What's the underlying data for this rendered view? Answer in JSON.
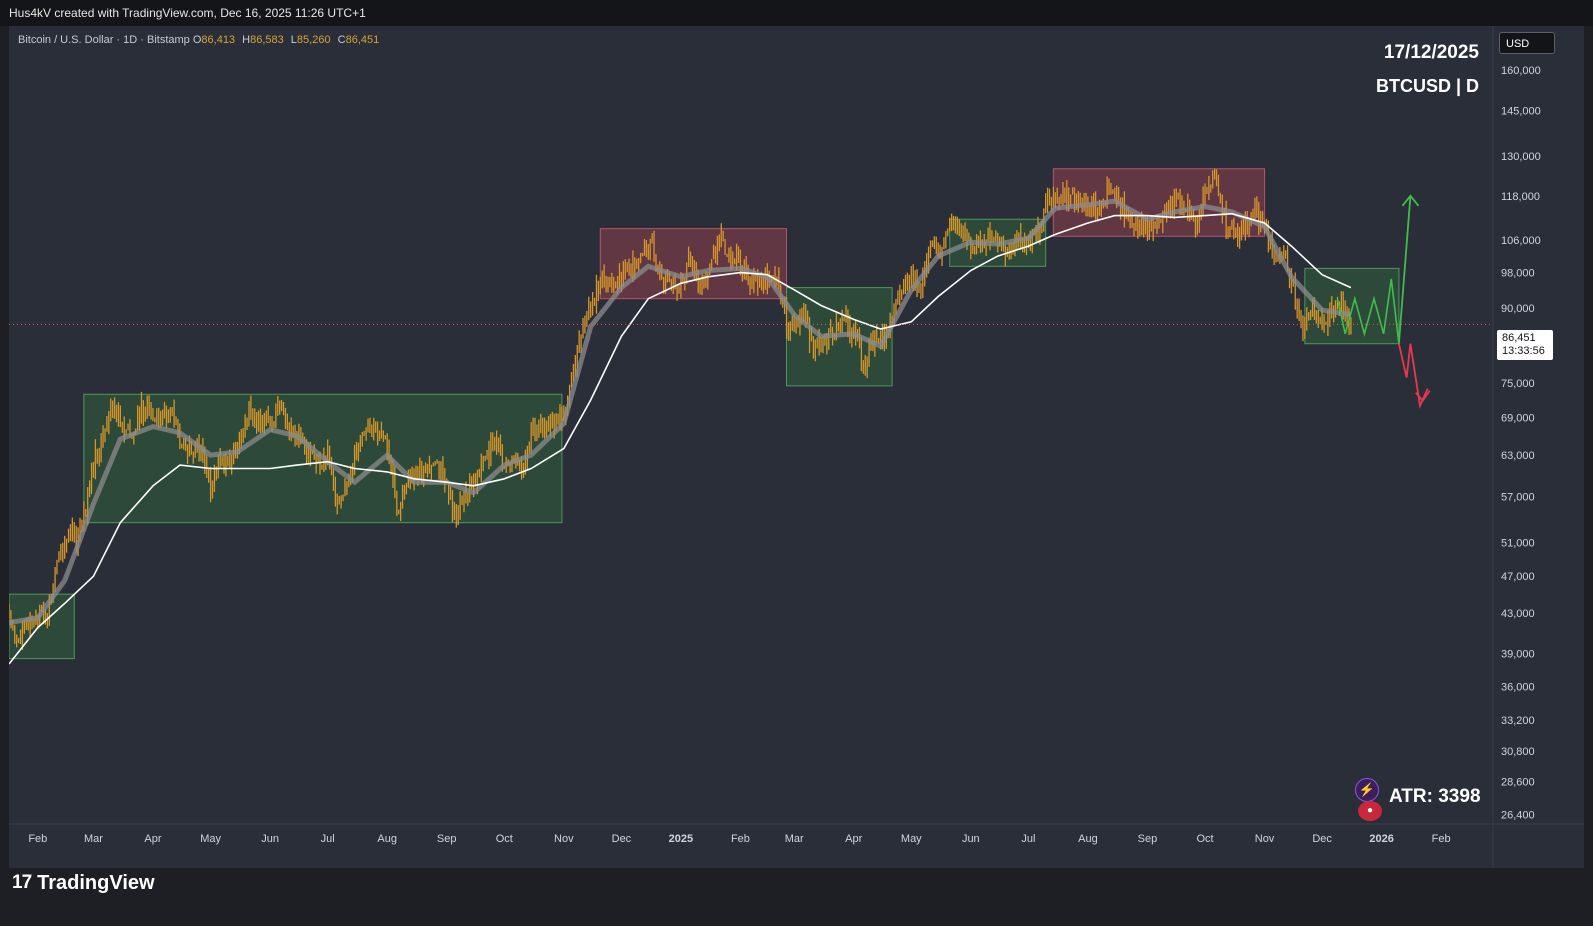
{
  "header": {
    "attribution": "Hus4kV created with TradingView.com, Dec 16, 2025 11:26 UTC+1"
  },
  "symbol": {
    "description": "Bitcoin / U.S. Dollar · 1D · Bitstamp",
    "o_label": "O",
    "o_value": "86,413",
    "h_label": "H",
    "h_value": "86,583",
    "l_label": "L",
    "l_value": "85,260",
    "c_label": "C",
    "c_value": "86,451"
  },
  "overlay": {
    "date": "17/12/2025",
    "pair": "BTCUSD | D",
    "atr": "ATR: 3398"
  },
  "currency_button": "USD",
  "last_price": {
    "price": "86,451",
    "countdown": "13:33:56"
  },
  "brand": {
    "logo": "17",
    "name": "TradingView"
  },
  "colors": {
    "candle": "#d6962a",
    "ema_white": "#ffffff",
    "ema_gray": "#8c8c8c",
    "green_box": "#2f6b3a",
    "red_box": "#8e3f4f",
    "projection_up": "#3fbf4a",
    "projection_down": "#e6394e",
    "background": "#2a2e39"
  },
  "chart_data": {
    "type": "candlestick",
    "title": "Bitcoin / U.S. Dollar · 1D · Bitstamp",
    "scale": "log",
    "ylim": [
      25800,
      178000
    ],
    "y_ticks": [
      160000,
      145000,
      130000,
      118000,
      106000,
      98000,
      90000,
      75000,
      69000,
      63000,
      57000,
      51000,
      47000,
      43000,
      39000,
      36000,
      33200,
      30800,
      28600,
      26400
    ],
    "y_tick_labels": [
      "160,000",
      "145,000",
      "130,000",
      "118,000",
      "106,000",
      "98,000",
      "90,000",
      "75,000",
      "69,000",
      "63,000",
      "57,000",
      "51,000",
      "47,000",
      "43,000",
      "39,000",
      "36,000",
      "33,200",
      "30,800",
      "28,600",
      "26,400"
    ],
    "x_range": [
      "2024-01-17",
      "2026-02-28"
    ],
    "x_ticks": [
      {
        "date": "2024-02-01",
        "label": "Feb"
      },
      {
        "date": "2024-03-01",
        "label": "Mar"
      },
      {
        "date": "2024-04-01",
        "label": "Apr"
      },
      {
        "date": "2024-05-01",
        "label": "May"
      },
      {
        "date": "2024-06-01",
        "label": "Jun"
      },
      {
        "date": "2024-07-01",
        "label": "Jul"
      },
      {
        "date": "2024-08-01",
        "label": "Aug"
      },
      {
        "date": "2024-09-01",
        "label": "Sep"
      },
      {
        "date": "2024-10-01",
        "label": "Oct"
      },
      {
        "date": "2024-11-01",
        "label": "Nov"
      },
      {
        "date": "2024-12-01",
        "label": "Dec"
      },
      {
        "date": "2025-01-01",
        "label": "2025"
      },
      {
        "date": "2025-02-01",
        "label": "Feb"
      },
      {
        "date": "2025-03-01",
        "label": "Mar"
      },
      {
        "date": "2025-04-01",
        "label": "Apr"
      },
      {
        "date": "2025-05-01",
        "label": "May"
      },
      {
        "date": "2025-06-01",
        "label": "Jun"
      },
      {
        "date": "2025-07-01",
        "label": "Jul"
      },
      {
        "date": "2025-08-01",
        "label": "Aug"
      },
      {
        "date": "2025-09-01",
        "label": "Sep"
      },
      {
        "date": "2025-10-01",
        "label": "Oct"
      },
      {
        "date": "2025-11-01",
        "label": "Nov"
      },
      {
        "date": "2025-12-01",
        "label": "Dec"
      },
      {
        "date": "2026-01-01",
        "label": "2026"
      },
      {
        "date": "2026-02-01",
        "label": "Feb"
      }
    ],
    "close_series": [
      [
        "2024-01-17",
        42700
      ],
      [
        "2024-01-22",
        40000
      ],
      [
        "2024-01-27",
        41800
      ],
      [
        "2024-02-01",
        43000
      ],
      [
        "2024-02-06",
        43000
      ],
      [
        "2024-02-11",
        48200
      ],
      [
        "2024-02-16",
        52000
      ],
      [
        "2024-02-21",
        51500
      ],
      [
        "2024-02-26",
        55000
      ],
      [
        "2024-03-01",
        62000
      ],
      [
        "2024-03-06",
        66000
      ],
      [
        "2024-03-11",
        71500
      ],
      [
        "2024-03-16",
        67000
      ],
      [
        "2024-03-21",
        66000
      ],
      [
        "2024-03-26",
        70500
      ],
      [
        "2024-04-01",
        69500
      ],
      [
        "2024-04-06",
        69000
      ],
      [
        "2024-04-11",
        70000
      ],
      [
        "2024-04-16",
        63500
      ],
      [
        "2024-04-21",
        64500
      ],
      [
        "2024-04-26",
        64000
      ],
      [
        "2024-05-01",
        58000
      ],
      [
        "2024-05-06",
        63000
      ],
      [
        "2024-05-11",
        61000
      ],
      [
        "2024-05-16",
        65500
      ],
      [
        "2024-05-21",
        70000
      ],
      [
        "2024-05-26",
        69000
      ],
      [
        "2024-06-01",
        67800
      ],
      [
        "2024-06-06",
        71000
      ],
      [
        "2024-06-11",
        67000
      ],
      [
        "2024-06-16",
        66500
      ],
      [
        "2024-06-21",
        64000
      ],
      [
        "2024-06-26",
        61500
      ],
      [
        "2024-07-01",
        62500
      ],
      [
        "2024-07-06",
        56500
      ],
      [
        "2024-07-11",
        58000
      ],
      [
        "2024-07-16",
        64500
      ],
      [
        "2024-07-21",
        67500
      ],
      [
        "2024-07-26",
        67000
      ],
      [
        "2024-08-01",
        64500
      ],
      [
        "2024-08-06",
        55000
      ],
      [
        "2024-08-11",
        59000
      ],
      [
        "2024-08-16",
        59500
      ],
      [
        "2024-08-21",
        61000
      ],
      [
        "2024-08-26",
        63000
      ],
      [
        "2024-09-01",
        58000
      ],
      [
        "2024-09-06",
        54500
      ],
      [
        "2024-09-11",
        57500
      ],
      [
        "2024-09-16",
        58500
      ],
      [
        "2024-09-21",
        63000
      ],
      [
        "2024-09-26",
        65000
      ],
      [
        "2024-10-01",
        61000
      ],
      [
        "2024-10-06",
        62500
      ],
      [
        "2024-10-11",
        61000
      ],
      [
        "2024-10-16",
        67500
      ],
      [
        "2024-10-21",
        67000
      ],
      [
        "2024-10-26",
        68000
      ],
      [
        "2024-11-01",
        69500
      ],
      [
        "2024-11-06",
        76000
      ],
      [
        "2024-11-11",
        88000
      ],
      [
        "2024-11-16",
        90500
      ],
      [
        "2024-11-21",
        98000
      ],
      [
        "2024-11-26",
        95000
      ],
      [
        "2024-12-01",
        96500
      ],
      [
        "2024-12-06",
        100000
      ],
      [
        "2024-12-11",
        101000
      ],
      [
        "2024-12-16",
        106000
      ],
      [
        "2024-12-21",
        97000
      ],
      [
        "2024-12-26",
        95500
      ],
      [
        "2025-01-01",
        94500
      ],
      [
        "2025-01-06",
        102000
      ],
      [
        "2025-01-11",
        94500
      ],
      [
        "2025-01-16",
        100000
      ],
      [
        "2025-01-21",
        105500
      ],
      [
        "2025-01-26",
        102000
      ],
      [
        "2025-02-01",
        100000
      ],
      [
        "2025-02-06",
        96500
      ],
      [
        "2025-02-11",
        97000
      ],
      [
        "2025-02-16",
        96500
      ],
      [
        "2025-02-21",
        96000
      ],
      [
        "2025-02-26",
        84500
      ],
      [
        "2025-03-01",
        86000
      ],
      [
        "2025-03-06",
        89500
      ],
      [
        "2025-03-11",
        81000
      ],
      [
        "2025-03-16",
        83500
      ],
      [
        "2025-03-21",
        84500
      ],
      [
        "2025-03-26",
        87000
      ],
      [
        "2025-04-01",
        85000
      ],
      [
        "2025-04-06",
        78000
      ],
      [
        "2025-04-11",
        83500
      ],
      [
        "2025-04-16",
        84000
      ],
      [
        "2025-04-21",
        87500
      ],
      [
        "2025-04-26",
        94500
      ],
      [
        "2025-05-01",
        96500
      ],
      [
        "2025-05-06",
        94000
      ],
      [
        "2025-05-11",
        104000
      ],
      [
        "2025-05-16",
        103500
      ],
      [
        "2025-05-21",
        109500
      ],
      [
        "2025-05-26",
        109000
      ],
      [
        "2025-06-01",
        105000
      ],
      [
        "2025-06-06",
        104500
      ],
      [
        "2025-06-11",
        108500
      ],
      [
        "2025-06-16",
        106000
      ],
      [
        "2025-06-21",
        102500
      ],
      [
        "2025-06-26",
        107000
      ],
      [
        "2025-07-01",
        105500
      ],
      [
        "2025-07-06",
        108000
      ],
      [
        "2025-07-11",
        117500
      ],
      [
        "2025-07-16",
        119000
      ],
      [
        "2025-07-21",
        117500
      ],
      [
        "2025-07-26",
        117500
      ],
      [
        "2025-08-01",
        114000
      ],
      [
        "2025-08-06",
        115000
      ],
      [
        "2025-08-11",
        119000
      ],
      [
        "2025-08-16",
        117500
      ],
      [
        "2025-08-21",
        113000
      ],
      [
        "2025-08-26",
        110000
      ],
      [
        "2025-09-01",
        109000
      ],
      [
        "2025-09-06",
        110500
      ],
      [
        "2025-09-11",
        114000
      ],
      [
        "2025-09-16",
        116500
      ],
      [
        "2025-09-21",
        115500
      ],
      [
        "2025-09-26",
        109500
      ],
      [
        "2025-10-01",
        118000
      ],
      [
        "2025-10-06",
        124500
      ],
      [
        "2025-10-11",
        112000
      ],
      [
        "2025-10-16",
        108500
      ],
      [
        "2025-10-21",
        108000
      ],
      [
        "2025-10-26",
        114000
      ],
      [
        "2025-11-01",
        110000
      ],
      [
        "2025-11-06",
        101500
      ],
      [
        "2025-11-11",
        103000
      ],
      [
        "2025-11-16",
        94500
      ],
      [
        "2025-11-21",
        85000
      ],
      [
        "2025-11-26",
        90500
      ],
      [
        "2025-12-01",
        86500
      ],
      [
        "2025-12-06",
        89500
      ],
      [
        "2025-12-11",
        92000
      ],
      [
        "2025-12-16",
        86451
      ]
    ],
    "ema_fast": [
      [
        "2024-01-17",
        42000
      ],
      [
        "2024-02-01",
        42500
      ],
      [
        "2024-02-15",
        46500
      ],
      [
        "2024-03-01",
        56000
      ],
      [
        "2024-03-15",
        65500
      ],
      [
        "2024-04-01",
        67500
      ],
      [
        "2024-04-15",
        66500
      ],
      [
        "2024-05-01",
        63000
      ],
      [
        "2024-05-15",
        63500
      ],
      [
        "2024-06-01",
        67000
      ],
      [
        "2024-06-15",
        66000
      ],
      [
        "2024-07-01",
        62000
      ],
      [
        "2024-07-15",
        59000
      ],
      [
        "2024-08-01",
        63000
      ],
      [
        "2024-08-15",
        59000
      ],
      [
        "2024-09-01",
        59000
      ],
      [
        "2024-09-15",
        57500
      ],
      [
        "2024-10-01",
        61500
      ],
      [
        "2024-10-15",
        63000
      ],
      [
        "2024-11-01",
        68000
      ],
      [
        "2024-11-15",
        86000
      ],
      [
        "2024-12-01",
        94500
      ],
      [
        "2024-12-15",
        99500
      ],
      [
        "2025-01-01",
        97000
      ],
      [
        "2025-01-15",
        98500
      ],
      [
        "2025-02-01",
        99000
      ],
      [
        "2025-02-15",
        97000
      ],
      [
        "2025-03-01",
        88500
      ],
      [
        "2025-03-15",
        84000
      ],
      [
        "2025-04-01",
        84500
      ],
      [
        "2025-04-15",
        82000
      ],
      [
        "2025-05-01",
        94000
      ],
      [
        "2025-05-15",
        102000
      ],
      [
        "2025-06-01",
        105500
      ],
      [
        "2025-06-15",
        105000
      ],
      [
        "2025-07-01",
        106500
      ],
      [
        "2025-07-15",
        114500
      ],
      [
        "2025-08-01",
        115500
      ],
      [
        "2025-08-15",
        116500
      ],
      [
        "2025-09-01",
        111500
      ],
      [
        "2025-09-15",
        113500
      ],
      [
        "2025-10-01",
        115000
      ],
      [
        "2025-10-15",
        113500
      ],
      [
        "2025-11-01",
        109500
      ],
      [
        "2025-11-15",
        97000
      ],
      [
        "2025-12-01",
        89500
      ],
      [
        "2025-12-16",
        88500
      ]
    ],
    "ema_slow": [
      [
        "2024-01-17",
        38000
      ],
      [
        "2024-02-01",
        41500
      ],
      [
        "2024-02-15",
        44000
      ],
      [
        "2024-03-01",
        47000
      ],
      [
        "2024-03-15",
        53500
      ],
      [
        "2024-04-01",
        58500
      ],
      [
        "2024-04-15",
        61500
      ],
      [
        "2024-05-01",
        61000
      ],
      [
        "2024-05-15",
        61000
      ],
      [
        "2024-06-01",
        61000
      ],
      [
        "2024-06-15",
        61500
      ],
      [
        "2024-07-01",
        62000
      ],
      [
        "2024-07-15",
        61000
      ],
      [
        "2024-08-01",
        60500
      ],
      [
        "2024-08-15",
        59500
      ],
      [
        "2024-09-01",
        59000
      ],
      [
        "2024-09-15",
        58500
      ],
      [
        "2024-10-01",
        59500
      ],
      [
        "2024-10-15",
        61000
      ],
      [
        "2024-11-01",
        64000
      ],
      [
        "2024-11-15",
        72000
      ],
      [
        "2024-12-01",
        84000
      ],
      [
        "2024-12-15",
        92000
      ],
      [
        "2025-01-01",
        95500
      ],
      [
        "2025-01-15",
        97000
      ],
      [
        "2025-02-01",
        98000
      ],
      [
        "2025-02-15",
        97500
      ],
      [
        "2025-03-01",
        94000
      ],
      [
        "2025-03-15",
        90500
      ],
      [
        "2025-04-01",
        87500
      ],
      [
        "2025-04-15",
        85500
      ],
      [
        "2025-05-01",
        87000
      ],
      [
        "2025-05-15",
        92500
      ],
      [
        "2025-06-01",
        98500
      ],
      [
        "2025-06-15",
        102000
      ],
      [
        "2025-07-01",
        104500
      ],
      [
        "2025-07-15",
        107500
      ],
      [
        "2025-08-01",
        110500
      ],
      [
        "2025-08-15",
        112500
      ],
      [
        "2025-09-01",
        112500
      ],
      [
        "2025-09-15",
        112000
      ],
      [
        "2025-10-01",
        112500
      ],
      [
        "2025-10-15",
        113000
      ],
      [
        "2025-11-01",
        110500
      ],
      [
        "2025-11-15",
        104500
      ],
      [
        "2025-12-01",
        97500
      ],
      [
        "2025-12-16",
        94500
      ]
    ],
    "zones": [
      {
        "type": "accumulation",
        "from": "2024-01-17",
        "to": "2024-02-20",
        "low": 38500,
        "high": 45000
      },
      {
        "type": "accumulation",
        "from": "2024-02-25",
        "to": "2024-10-31",
        "low": 53500,
        "high": 73000
      },
      {
        "type": "distribution",
        "from": "2024-11-20",
        "to": "2025-02-25",
        "low": 92000,
        "high": 109000
      },
      {
        "type": "accumulation",
        "from": "2025-02-25",
        "to": "2025-04-21",
        "low": 74500,
        "high": 94500
      },
      {
        "type": "accumulation",
        "from": "2025-05-21",
        "to": "2025-07-10",
        "low": 99500,
        "high": 111500
      },
      {
        "type": "distribution",
        "from": "2025-07-14",
        "to": "2025-11-01",
        "low": 107000,
        "high": 126000
      },
      {
        "type": "accumulation",
        "from": "2025-11-22",
        "to": "2026-01-10",
        "low": 82500,
        "high": 99000
      }
    ],
    "projection_range": [
      [
        "2025-12-09",
        92000
      ],
      [
        "2025-12-13",
        84500
      ],
      [
        "2025-12-18",
        92000
      ],
      [
        "2025-12-23",
        84500
      ],
      [
        "2025-12-28",
        92000
      ],
      [
        "2026-01-02",
        84500
      ],
      [
        "2026-01-06",
        96500
      ],
      [
        "2026-01-10",
        82500
      ]
    ],
    "projection_up": [
      [
        "2026-01-10",
        82500
      ],
      [
        "2026-01-16",
        118000
      ]
    ],
    "projection_down": [
      [
        "2026-01-10",
        82500
      ],
      [
        "2026-01-14",
        76000
      ],
      [
        "2026-01-16",
        82500
      ],
      [
        "2026-01-21",
        71000
      ],
      [
        "2026-01-25",
        74000
      ]
    ],
    "last_close": 86451
  }
}
